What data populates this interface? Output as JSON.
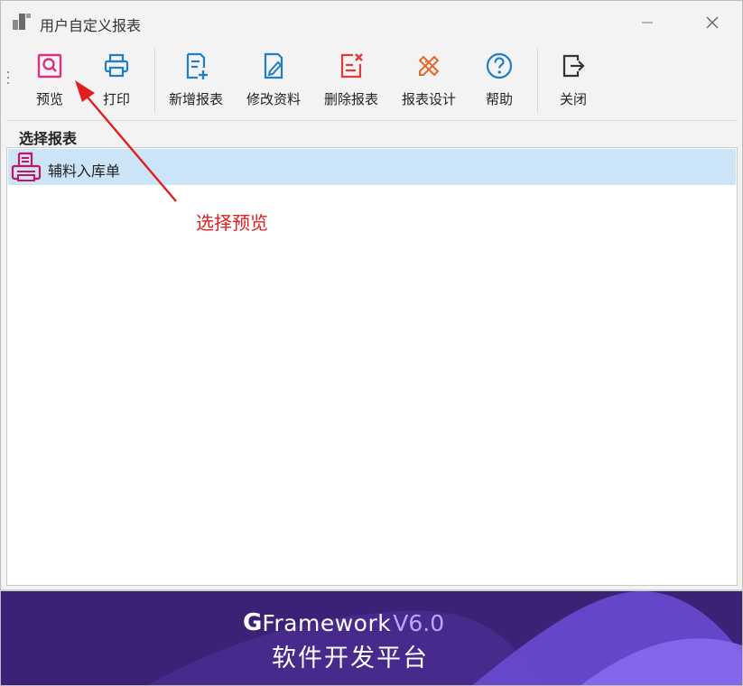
{
  "window": {
    "title": "用户自定义报表",
    "minimize_glyph": "—",
    "close_glyph": "✕"
  },
  "toolbar": {
    "buttons": [
      {
        "label": "预览",
        "icon": "preview-icon",
        "color": "#d63384"
      },
      {
        "label": "打印",
        "icon": "printer-icon",
        "color": "#1e7fc8"
      },
      {
        "label": "新增报表",
        "icon": "new-report-icon",
        "color": "#1e7fc8"
      },
      {
        "label": "修改资料",
        "icon": "edit-icon",
        "color": "#1e7fc8"
      },
      {
        "label": "删除报表",
        "icon": "delete-report-icon",
        "color": "#e03a3a"
      },
      {
        "label": "报表设计",
        "icon": "design-icon",
        "color": "#e06a2a"
      },
      {
        "label": "帮助",
        "icon": "help-icon",
        "color": "#1e7fc8"
      },
      {
        "label": "关闭",
        "icon": "exit-icon",
        "color": "#333333"
      }
    ]
  },
  "panel": {
    "header": "选择报表",
    "items": [
      {
        "label": "辅料入库单",
        "icon": "report-printer-icon",
        "selected": true,
        "selected_color": "#cce4f7"
      }
    ]
  },
  "annotation": {
    "text": "选择预览",
    "color": "#e02020"
  },
  "banner": {
    "brand_g": "G",
    "brand_name": "Framework",
    "version": "V6.0",
    "slogan": "软件开发平台",
    "bg_color": "#3c2277"
  }
}
